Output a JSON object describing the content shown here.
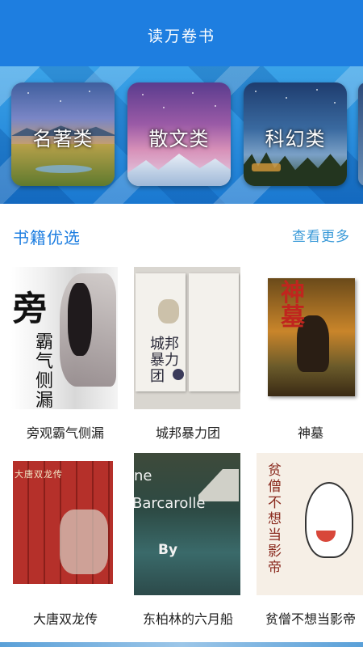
{
  "app": {
    "title": "读万卷书"
  },
  "categories": [
    {
      "label": "名著类"
    },
    {
      "label": "散文类"
    },
    {
      "label": "科幻类"
    }
  ],
  "section": {
    "title": "书籍优选",
    "more_label": "查看更多"
  },
  "books": [
    {
      "title": "旁观霸气侧漏",
      "cover_text": "霸气侧漏"
    },
    {
      "title": "城邦暴力团",
      "cover_text": "城邦暴力团"
    },
    {
      "title": "神墓",
      "cover_text": "神墓"
    },
    {
      "title": "大唐双龙传",
      "cover_text": "大唐双龙传"
    },
    {
      "title": "东柏林的六月船",
      "cover_text": "Barcarolle"
    },
    {
      "title": "贫僧不想当影帝",
      "cover_text": "贫僧不想当影帝"
    }
  ],
  "colors": {
    "primary": "#1e7ee0",
    "link": "#3a9ad8"
  }
}
